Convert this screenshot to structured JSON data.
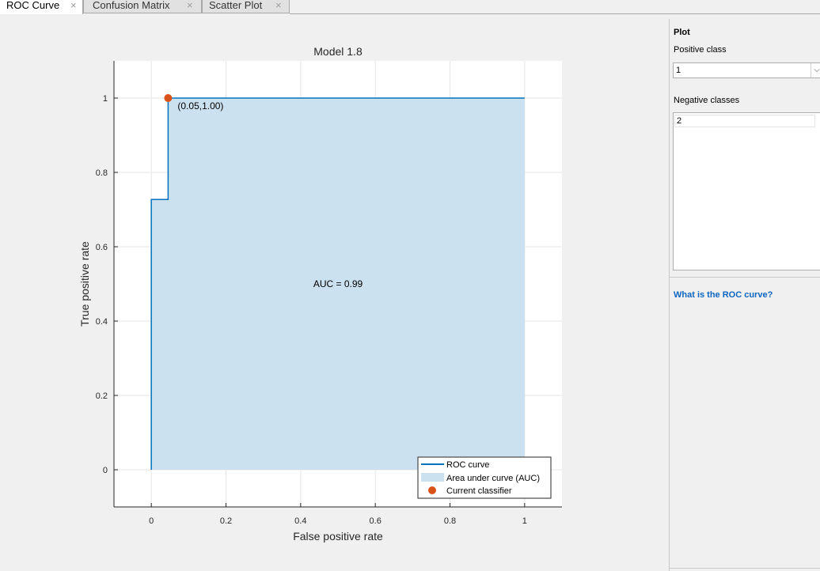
{
  "tabs": [
    {
      "label": "ROC Curve",
      "close": "×",
      "active": true
    },
    {
      "label": "Confusion Matrix",
      "close": "×",
      "active": false
    },
    {
      "label": "Scatter Plot",
      "close": "×",
      "active": false
    }
  ],
  "side_panel": {
    "section_title": "Plot",
    "positive_class_label": "Positive class",
    "positive_class_value": "1",
    "dropdown_arrow": "⌵",
    "negative_classes_label": "Negative classes",
    "negative_classes": [
      "2"
    ],
    "help_link": "What is the ROC curve?"
  },
  "chart_data": {
    "type": "line",
    "title": "Model 1.8",
    "xlabel": "False positive rate",
    "ylabel": "True positive rate",
    "xlim": [
      -0.1,
      1.1
    ],
    "ylim": [
      -0.1,
      1.1
    ],
    "xticks": [
      0,
      0.2,
      0.4,
      0.6,
      0.8,
      1
    ],
    "xtick_labels": [
      "0",
      "0.2",
      "0.4",
      "0.6",
      "0.8",
      "1"
    ],
    "yticks": [
      0,
      0.2,
      0.4,
      0.6,
      0.8,
      1
    ],
    "ytick_labels": [
      "0",
      "0.2",
      "0.4",
      "0.6",
      "0.8",
      "1"
    ],
    "grid": true,
    "roc_curve": {
      "name": "ROC curve",
      "x": [
        0,
        0,
        0,
        0.045,
        0.045,
        1
      ],
      "y": [
        0,
        0.727,
        0.727,
        0.727,
        1.0,
        1.0
      ],
      "color": "#0072bd"
    },
    "auc_area": {
      "name": "Area under curve (AUC)",
      "color": "#cce1f0"
    },
    "current_classifier": {
      "name": "Current classifier",
      "x": 0.045,
      "y": 1.0,
      "label": "(0.05,1.00)",
      "color": "#d95319"
    },
    "auc_text": {
      "text": "AUC = 0.99",
      "x": 0.5,
      "y": 0.5
    },
    "legend": {
      "placement": "bottom-right",
      "entries": [
        "ROC curve",
        "Area under curve (AUC)",
        "Current classifier"
      ]
    }
  }
}
